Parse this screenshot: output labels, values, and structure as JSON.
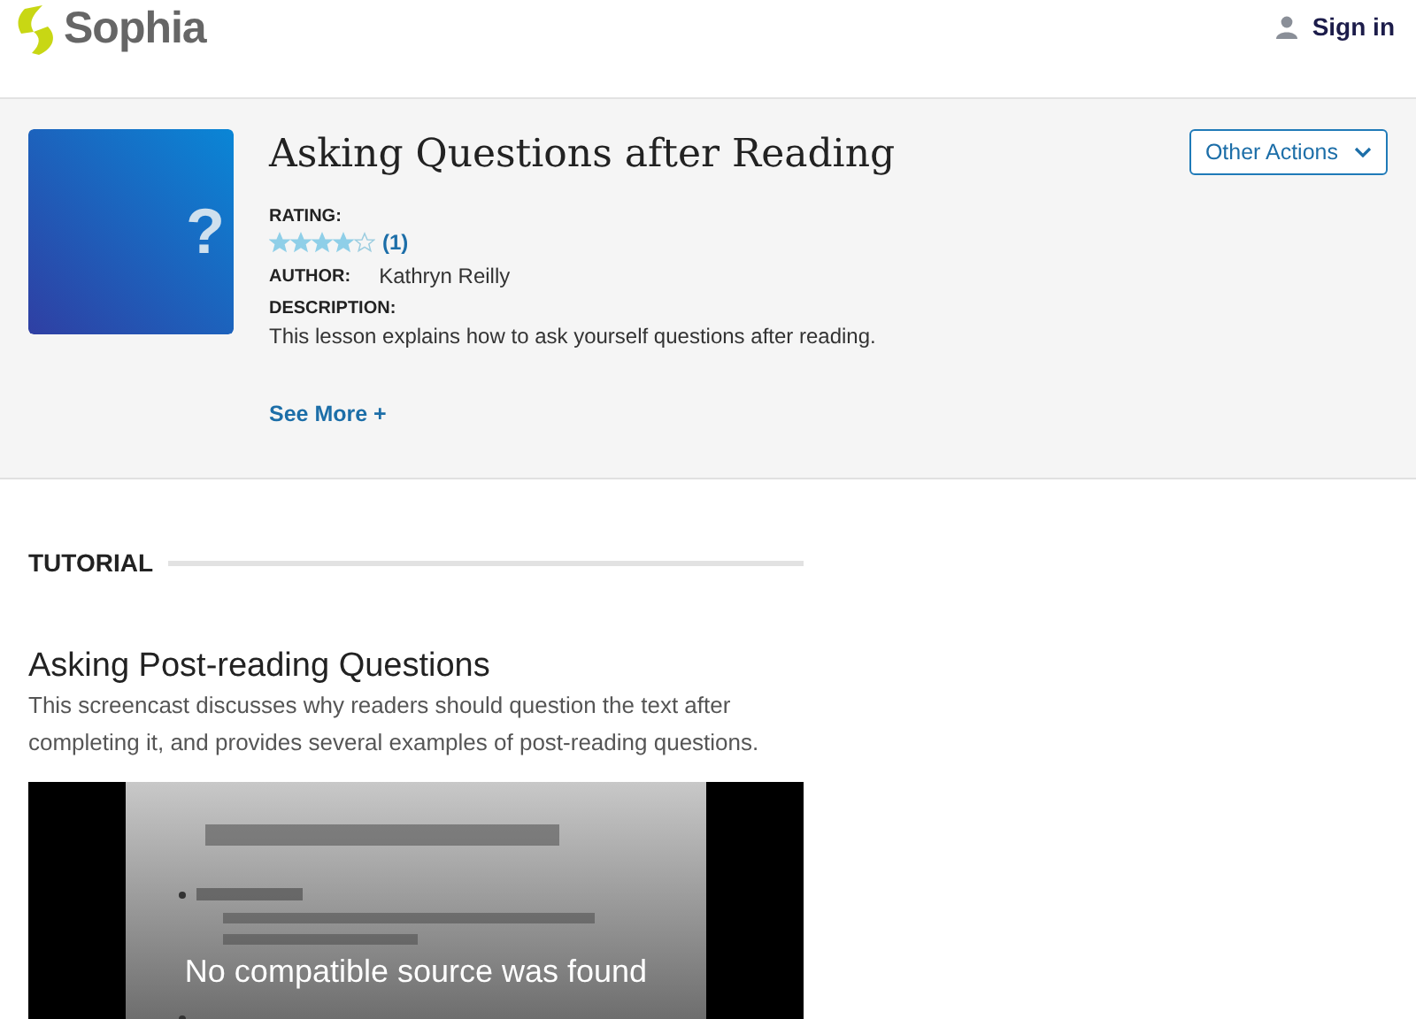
{
  "header": {
    "logo": "Sophia",
    "sign_in": "Sign in"
  },
  "lesson": {
    "thumbnail_glyph": "?",
    "title": "Asking Questions after Reading",
    "rating_label": "RATING:",
    "stars": 4,
    "rating_count": "(1)",
    "author_label": "AUTHOR:",
    "author": "Kathryn Reilly",
    "description_label": "DESCRIPTION:",
    "description": "This lesson explains how to ask yourself questions after reading.",
    "see_more": "See More +",
    "actions_button": "Other Actions"
  },
  "tutorial": {
    "section_label": "TUTORIAL",
    "title": "Asking Post-reading Questions",
    "description": "This screencast discusses why readers should question the text after completing it, and provides several examples of post-reading questions.",
    "video": {
      "kind": "picture",
      "error": "No compatible source was found"
    }
  }
}
